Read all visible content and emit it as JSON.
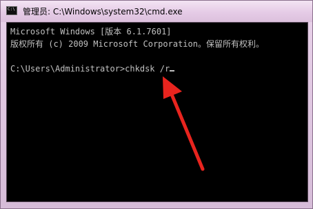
{
  "window": {
    "title": "管理员: C:\\Windows\\system32\\cmd.exe",
    "icon": "cmd-icon"
  },
  "console": {
    "line1": "Microsoft Windows [版本 6.1.7601]",
    "line2": "版权所有 (c) 2009 Microsoft Corporation。保留所有权利。",
    "prompt": "C:\\Users\\Administrator>",
    "command": "chkdsk /r"
  },
  "colors": {
    "arrow": "#e8241e",
    "console_bg": "#000000",
    "console_text": "#c0c0c0"
  }
}
